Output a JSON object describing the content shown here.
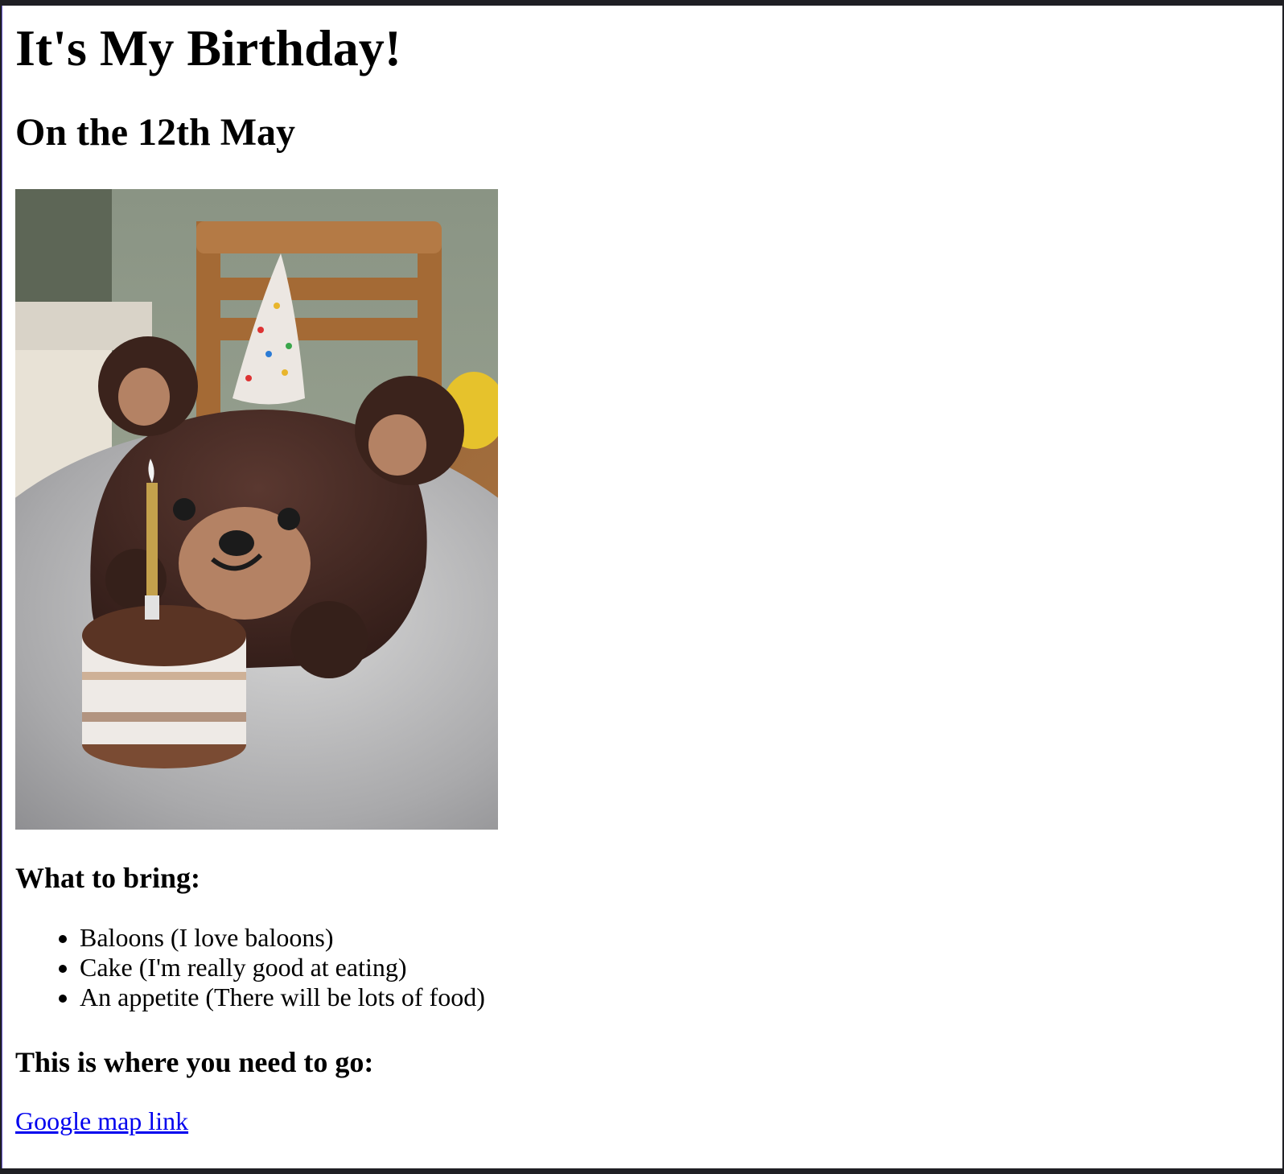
{
  "page": {
    "title": "It's My Birthday!",
    "subtitle": "On the 12th May",
    "photo_description_icon": "birthday-cake-photo"
  },
  "bring": {
    "heading": "What to bring:",
    "items": [
      "Baloons (I love baloons)",
      "Cake (I'm really good at eating)",
      "An appetite (There will be lots of food)"
    ]
  },
  "directions": {
    "heading": "This is where you need to go:",
    "link_text": "Google map link",
    "link_color": "#0000ee"
  }
}
